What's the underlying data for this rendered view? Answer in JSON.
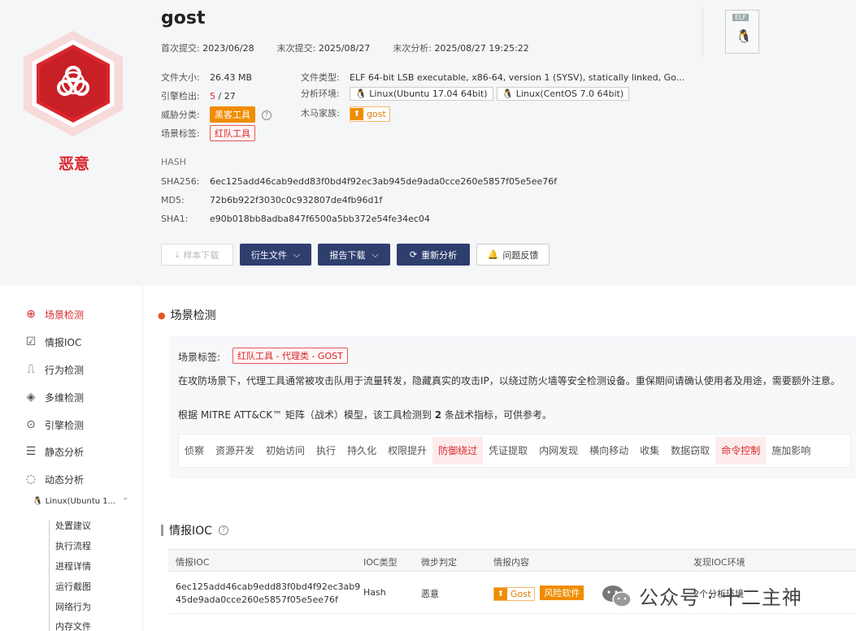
{
  "file": {
    "name": "gost",
    "verdict": "恶意",
    "first_submit_label": "首次提交:",
    "first_submit": "2023/06/28",
    "last_submit_label": "末次提交:",
    "last_submit": "2025/08/27",
    "last_analysis_label": "末次分析:",
    "last_analysis": "2025/08/27 19:25:22",
    "size_label": "文件大小:",
    "size": "26.43 MB",
    "type_label": "文件类型:",
    "type": "ELF 64-bit LSB executable, x86-64, version 1 (SYSV), statically linked, Go...",
    "engine_label": "引擎检出:",
    "engine_hits": "5",
    "engine_total": " / 27",
    "env_label": "分析环境:",
    "env_1": "Linux(Ubuntu 17.04 64bit)",
    "env_2": "Linux(CentOS 7.0 64bit)",
    "threat_label": "威胁分类:",
    "threat": "黑客工具",
    "family_label": "木马家族:",
    "family": "gost",
    "scene_label": "场景标签:",
    "scene": "红队工具",
    "elf_badge": "ELF"
  },
  "hash": {
    "title": "HASH",
    "sha256_label": "SHA256:",
    "sha256": "6ec125add46cab9edd83f0bd4f92ec3ab945de9ada0cce260e5857f05e5ee76f",
    "md5_label": "MD5:",
    "md5": "72b6b922f3030c0c932807de4fb96d1f",
    "sha1_label": "SHA1:",
    "sha1": "e90b018bb8adba847f6500a5bb372e54fe34ec04"
  },
  "buttons": {
    "download": "样本下载",
    "derived": "衍生文件",
    "report": "报告下载",
    "reanalyze": "重新分析",
    "feedback": "问题反馈"
  },
  "sidebar": {
    "items": [
      "场景检测",
      "情报IOC",
      "行为检测",
      "多维检测",
      "引擎检测",
      "静态分析",
      "动态分析"
    ],
    "os_item": "Linux(Ubuntu 1...",
    "sub_items": [
      "处置建议",
      "执行流程",
      "进程详情",
      "运行截图",
      "网络行为",
      "内存文件"
    ]
  },
  "scene": {
    "title": "场景检测",
    "tag_label": "场景标签:",
    "tag": "红队工具 - 代理类 - GOST",
    "desc": "在攻防场景下，代理工具通常被攻击队用于流量转发，隐藏真实的攻击IP，以绕过防火墙等安全检测设备。重保期间请确认使用者及用途，需要额外注意。",
    "mitre_prefix": "根据 MITRE ATT&CK™ 矩阵（战术）模型，该工具检测到",
    "mitre_count": "2",
    "mitre_suffix": "条战术指标，可供参考。",
    "tactics": [
      "侦察",
      "资源开发",
      "初始访问",
      "执行",
      "持久化",
      "权限提升",
      "防御绕过",
      "凭证提取",
      "内网发现",
      "横向移动",
      "收集",
      "数据窃取",
      "命令控制",
      "施加影响"
    ]
  },
  "ioc": {
    "title": "情报IOC",
    "headers": [
      "情报IOC",
      "IOC类型",
      "微步判定",
      "情报内容",
      "发现IOC环境"
    ],
    "row": {
      "ioc_line1": "6ec125add46cab9edd83f0bd4f92ec3ab9",
      "ioc_line2": "45de9ada0cce260e5857f05e5ee76f",
      "type": "Hash",
      "verdict": "恶意",
      "content_tag": "Gost",
      "risk_tag": "风险软件",
      "env": "2个分析环境"
    }
  },
  "watermark": "公众号 · 十二主神",
  "colors": {
    "danger": "#d9272e",
    "accent": "#2e3f6e",
    "warning": "#f08c00"
  }
}
